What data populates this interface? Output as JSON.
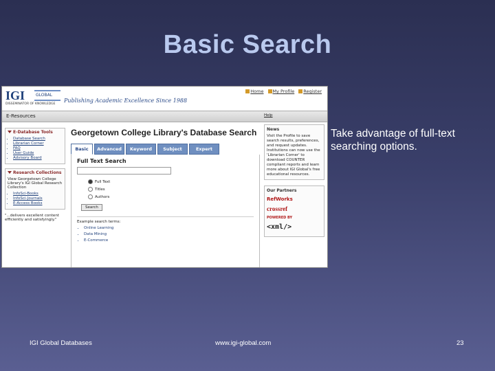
{
  "slide": {
    "title": "Basic Search",
    "callout": "Take advantage of full-text searching options.",
    "footer_left": "IGI Global Databases",
    "footer_center": "www.igi-global.com",
    "page_number": "23"
  },
  "screenshot": {
    "logo_text": "IGI",
    "logo_sub": "GLOBAL",
    "logo_tagline": "DISSEMINATOR OF KNOWLEDGE",
    "tagline": "Publishing Academic Excellence Since 1988",
    "top_links": [
      "Home",
      "My Profile",
      "Register"
    ],
    "nav_title": "E-Resources",
    "nav_help": "Help",
    "sidebar": {
      "tools_title": "E-Database Tools",
      "tools": [
        "Database Search",
        "Librarian Corner",
        "FAQ",
        "User Guide",
        "Advisory Board"
      ],
      "collections_title": "Research Collections",
      "collections_text": "View Georgetown College Library's IGI Global Research Collection",
      "collections": [
        "InfoSci-Books",
        "InfoSci-Journals",
        "E-Access Books"
      ],
      "footer_text": "\"...delivers excellent content efficiently and satisfyingly.\""
    },
    "main": {
      "heading": "Georgetown College Library's Database Search",
      "tabs": [
        "Basic",
        "Advanced",
        "Keyword",
        "Subject",
        "Expert"
      ],
      "panel_title": "Full Text Search",
      "radios": [
        "Full Text",
        "Titles",
        "Authors"
      ],
      "search_button": "Search",
      "examples_title": "Example search terms:",
      "examples": [
        "Online Learning",
        "Data Mining",
        "E-Commerce"
      ]
    },
    "right": {
      "news_title": "News",
      "news_text": "Visit the Profile to save search results, preferences, and request updates. Institutions can now use the 'Librarian Corner' to download COUNTER compliant reports and learn more about IGI Global's free educational resources.",
      "partners_title": "Our Partners",
      "partners": [
        "RefWorks",
        "crossref",
        "POWERED BY",
        "<xml/>"
      ]
    }
  }
}
